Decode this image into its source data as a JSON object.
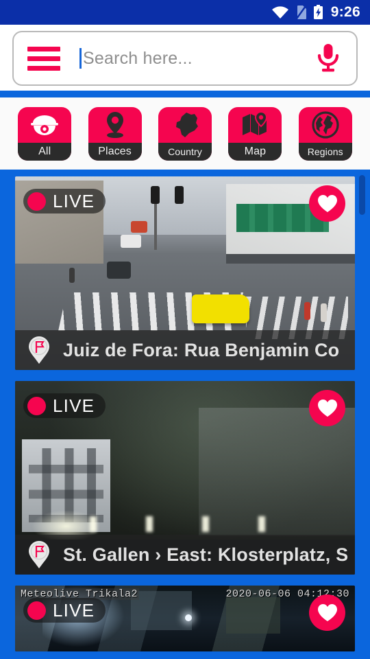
{
  "statusbar": {
    "time": "9:26",
    "icons": [
      "wifi-icon",
      "no-sim-icon",
      "battery-charging-icon"
    ]
  },
  "search": {
    "placeholder": "Search here...",
    "value": "",
    "menu_icon": "hamburger-menu-icon",
    "voice_icon": "microphone-icon"
  },
  "categories": [
    {
      "label": "All",
      "icon": "security-camera-icon"
    },
    {
      "label": "Places",
      "icon": "location-pin-icon"
    },
    {
      "label": "Country",
      "icon": "country-shape-icon"
    },
    {
      "label": "Map",
      "icon": "folded-map-icon"
    },
    {
      "label": "Regions",
      "icon": "globe-icon"
    }
  ],
  "cameras": [
    {
      "title": "Juiz de Fora: Rua Benjamin Co",
      "live_label": "LIVE",
      "favorite_icon": "heart-icon",
      "pin_icon": "flag-pin-icon",
      "overlay_left": "",
      "overlay_right": ""
    },
    {
      "title": "St. Gallen › East: Klosterplatz, S",
      "live_label": "LIVE",
      "favorite_icon": "heart-icon",
      "pin_icon": "flag-pin-icon",
      "overlay_left": "",
      "overlay_right": ""
    },
    {
      "title": "",
      "live_label": "LIVE",
      "favorite_icon": "heart-icon",
      "pin_icon": "flag-pin-icon",
      "overlay_left": "Meteolive Trikala2",
      "overlay_right": "2020-06-06 04:12:30"
    }
  ],
  "colors": {
    "status_bar": "#0b2fa8",
    "app_background": "#0b66dd",
    "accent_pink": "#f5054f",
    "chip_label_bg": "#2b2b2b",
    "caption_bg": "rgba(35,35,35,.72)"
  }
}
